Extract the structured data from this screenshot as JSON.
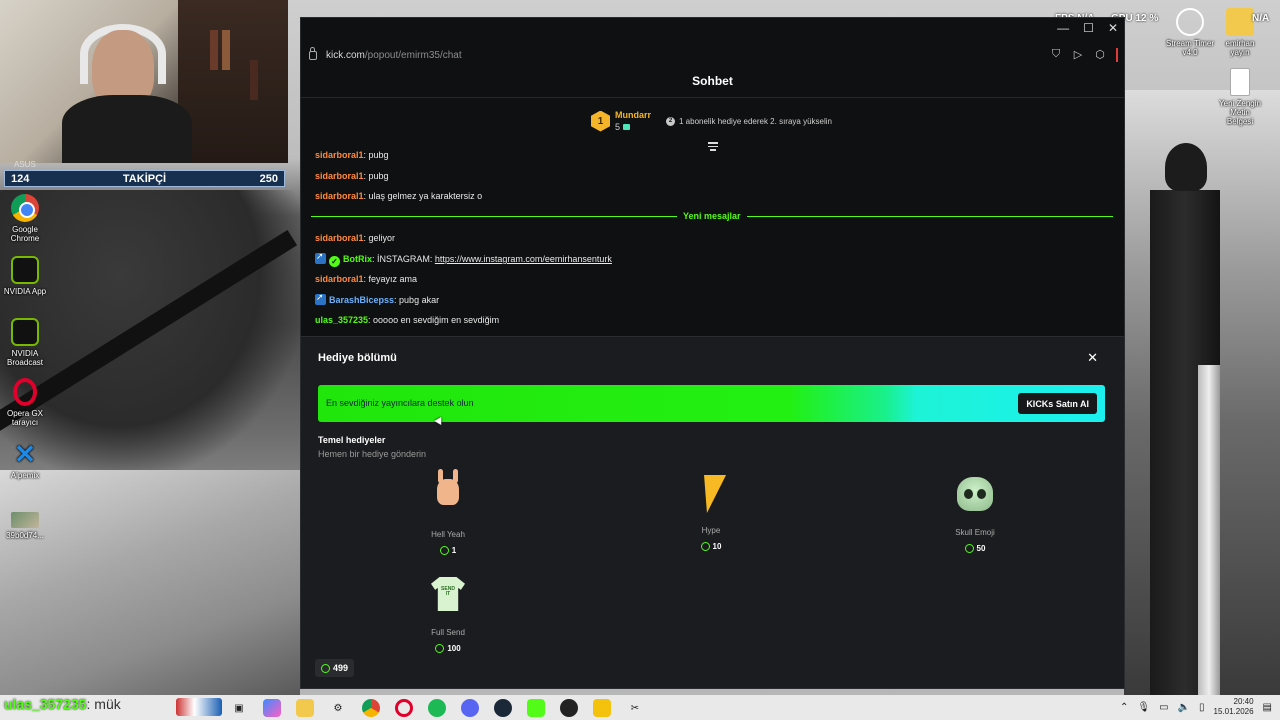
{
  "stream": {
    "follower_bar": {
      "left": "124",
      "label": "TAKİPÇİ",
      "right": "250"
    },
    "asus_label": "ASUS",
    "overlay_username": "ulas_357235",
    "overlay_suffix": ": mük"
  },
  "hud": {
    "fps_label": "FPS",
    "fps_value": "N/A",
    "gpu_label": "GPU",
    "gpu_value": "12 %",
    "extra_value": "N/A"
  },
  "desktop": {
    "left_icons": [
      {
        "label": "Google Chrome",
        "icon": "chrome-icon"
      },
      {
        "label": "NVIDIA App",
        "icon": "nvidia-icon"
      },
      {
        "label": "NVIDIA Broadcast",
        "icon": "nvidia-broadcast-icon"
      },
      {
        "label": "Opera GX tarayıcı",
        "icon": "opera-gx-icon"
      },
      {
        "label": "Alpemix",
        "icon": "alpemix-icon"
      },
      {
        "label": "39b0d74...",
        "icon": "image-file-icon"
      }
    ],
    "right_icons": [
      {
        "label": "Stream Timer v4.0",
        "icon": "timer-icon"
      },
      {
        "label": "emirhan yayın",
        "icon": "folder-icon"
      },
      {
        "label": "Yeni Zengin Metin Belgesi",
        "icon": "document-icon"
      }
    ]
  },
  "browser": {
    "url_host": "kick.com",
    "url_path": "/popout/emirm35/chat",
    "chat_title": "Sohbet",
    "leaderboard": {
      "rank": "1",
      "name": "Mundarr",
      "count": "5",
      "hint": "1 abonelik hediye ederek 2. sıraya yükselin"
    },
    "messages": [
      {
        "user": "sidarboral1",
        "text": ": pubg",
        "color": "#ff8a3d"
      },
      {
        "user": "sidarboral1",
        "text": ": pubg",
        "color": "#ff8a3d"
      },
      {
        "user": "sidarboral1",
        "text": ": ulaş gelmez ya karaktersiz o",
        "color": "#ff8a3d"
      },
      {
        "user": "sidarboral1",
        "text": ": geliyor",
        "color": "#ff8a3d"
      },
      {
        "user": "BotRix",
        "text": ": İNSTAGRAM: ",
        "link": "https://www.instagram.com/eemirhansenturk",
        "color": "#53fc18"
      },
      {
        "user": "sidarboral1",
        "text": ": feyayız ama",
        "color": "#ff8a3d"
      },
      {
        "user": "BarashBicepss",
        "text": ": pubg akar",
        "color": "#6cb2ff"
      },
      {
        "user": "ulas_357235",
        "text": ": ooooo en sevdiğim en sevdiğim",
        "color": "#53fc18"
      }
    ],
    "new_messages_label": "Yeni mesajlar",
    "gift_panel": {
      "title": "Hediye bölümü",
      "promo_text": "En sevdiğiniz yayıncılara destek olun",
      "promo_button": "KICKs Satın Al",
      "section_title": "Temel hediyeler",
      "section_subtitle": "Hemen bir hediye gönderin",
      "gifts": [
        {
          "name": "Hell Yeah",
          "price": "1",
          "icon": "rock-hand-icon"
        },
        {
          "name": "Hype",
          "price": "10",
          "icon": "lightning-icon"
        },
        {
          "name": "Skull Emoji",
          "price": "50",
          "icon": "skull-icon"
        },
        {
          "name": "Full Send",
          "price": "100",
          "icon": "shirt-icon"
        }
      ],
      "balance": "499"
    }
  },
  "taskbar": {
    "time": "20:40",
    "date": "15.01.2026"
  },
  "colors": {
    "kick_green": "#53fc18",
    "panel_bg": "#1b1c1f",
    "chat_bg": "#0f1011",
    "leader_gold": "#f5b52b"
  }
}
